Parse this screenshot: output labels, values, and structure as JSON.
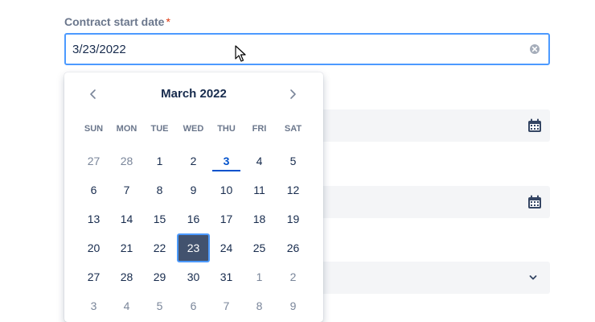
{
  "field": {
    "label": "Contract start date",
    "required_mark": "*",
    "value": "3/23/2022"
  },
  "calendar": {
    "month_title": "March 2022",
    "weekdays": [
      "SUN",
      "MON",
      "TUE",
      "WED",
      "THU",
      "FRI",
      "SAT"
    ],
    "weeks": [
      [
        {
          "d": "27",
          "m": "prev"
        },
        {
          "d": "28",
          "m": "prev"
        },
        {
          "d": "1",
          "m": "cur"
        },
        {
          "d": "2",
          "m": "cur"
        },
        {
          "d": "3",
          "m": "cur",
          "today": true
        },
        {
          "d": "4",
          "m": "cur"
        },
        {
          "d": "5",
          "m": "cur"
        }
      ],
      [
        {
          "d": "6",
          "m": "cur"
        },
        {
          "d": "7",
          "m": "cur"
        },
        {
          "d": "8",
          "m": "cur"
        },
        {
          "d": "9",
          "m": "cur"
        },
        {
          "d": "10",
          "m": "cur"
        },
        {
          "d": "11",
          "m": "cur"
        },
        {
          "d": "12",
          "m": "cur"
        }
      ],
      [
        {
          "d": "13",
          "m": "cur"
        },
        {
          "d": "14",
          "m": "cur"
        },
        {
          "d": "15",
          "m": "cur"
        },
        {
          "d": "16",
          "m": "cur"
        },
        {
          "d": "17",
          "m": "cur"
        },
        {
          "d": "18",
          "m": "cur"
        },
        {
          "d": "19",
          "m": "cur"
        }
      ],
      [
        {
          "d": "20",
          "m": "cur"
        },
        {
          "d": "21",
          "m": "cur"
        },
        {
          "d": "22",
          "m": "cur"
        },
        {
          "d": "23",
          "m": "cur",
          "selected": true
        },
        {
          "d": "24",
          "m": "cur"
        },
        {
          "d": "25",
          "m": "cur"
        },
        {
          "d": "26",
          "m": "cur"
        }
      ],
      [
        {
          "d": "27",
          "m": "cur"
        },
        {
          "d": "28",
          "m": "cur"
        },
        {
          "d": "29",
          "m": "cur"
        },
        {
          "d": "30",
          "m": "cur"
        },
        {
          "d": "31",
          "m": "cur"
        },
        {
          "d": "1",
          "m": "next"
        },
        {
          "d": "2",
          "m": "next"
        }
      ],
      [
        {
          "d": "3",
          "m": "next"
        },
        {
          "d": "4",
          "m": "next"
        },
        {
          "d": "5",
          "m": "next"
        },
        {
          "d": "6",
          "m": "next"
        },
        {
          "d": "7",
          "m": "next"
        },
        {
          "d": "8",
          "m": "next"
        },
        {
          "d": "9",
          "m": "next"
        }
      ]
    ]
  },
  "colors": {
    "focus_border": "#4c9aff",
    "selected_day_bg": "#42526e",
    "today_accent": "#0052cc",
    "required": "#de350b"
  },
  "icons": {
    "clear": "clear-icon",
    "prev": "chevron-left-icon",
    "next": "chevron-right-icon",
    "calendar": "calendar-icon",
    "dropdown": "chevron-down-icon"
  }
}
